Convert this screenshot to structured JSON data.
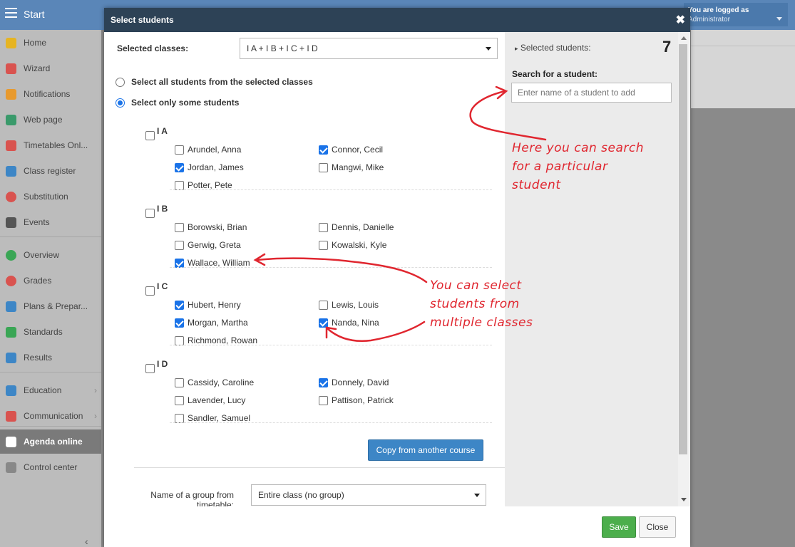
{
  "topbar": {
    "title": "Start"
  },
  "user": {
    "line1": "You are logged as",
    "line2": "Administrator"
  },
  "sidebar": {
    "items": [
      {
        "label": "Home",
        "icon": "star-icon",
        "color": "#e6b422"
      },
      {
        "label": "Wizard",
        "icon": "wand-icon",
        "color": "#d9534f"
      },
      {
        "label": "Notifications",
        "icon": "envelope-icon",
        "color": "#e89a2e"
      },
      {
        "label": "Web page",
        "icon": "house-icon",
        "color": "#3a9a6b"
      },
      {
        "label": "Timetables Onl...",
        "icon": "calendar-grid-icon",
        "color": "#d9534f"
      },
      {
        "label": "Class register",
        "icon": "book-icon",
        "color": "#3d86c6"
      },
      {
        "label": "Substitution",
        "icon": "person-icon",
        "color": "#d9534f"
      },
      {
        "label": "Events",
        "icon": "calendar-icon",
        "color": "#555555"
      },
      {
        "label": "Overview",
        "icon": "check-circle-icon",
        "color": "#3aa655"
      },
      {
        "label": "Grades",
        "icon": "chart-circle-icon",
        "color": "#d9534f"
      },
      {
        "label": "Plans & Prepar...",
        "icon": "briefcase-icon",
        "color": "#3d86c6"
      },
      {
        "label": "Standards",
        "icon": "shield-check-icon",
        "color": "#3aa655"
      },
      {
        "label": "Results",
        "icon": "bar-chart-icon",
        "color": "#3d86c6"
      },
      {
        "label": "Education",
        "icon": "books-icon",
        "color": "#3d86c6"
      },
      {
        "label": "Communication",
        "icon": "chat-icon",
        "color": "#d9534f"
      },
      {
        "label": "Agenda online",
        "icon": "feather-icon",
        "color": "#ffffff"
      },
      {
        "label": "Control center",
        "icon": "gear-icon",
        "color": "#888888"
      }
    ]
  },
  "modal": {
    "title": "Select students",
    "classes_label": "Selected classes:",
    "classes_value": "I A + I B + I C + I D",
    "radio_all": "Select all students from the selected classes",
    "radio_some": "Select only some students",
    "groups": [
      {
        "name": "I A",
        "students": [
          {
            "name": "Arundel, Anna",
            "checked": false
          },
          {
            "name": "Connor, Cecil",
            "checked": true
          },
          {
            "name": "Jordan, James",
            "checked": true
          },
          {
            "name": "Mangwi, Mike",
            "checked": false
          },
          {
            "name": "Potter, Pete",
            "checked": false
          }
        ]
      },
      {
        "name": "I B",
        "students": [
          {
            "name": "Borowski, Brian",
            "checked": false
          },
          {
            "name": "Dennis, Danielle",
            "checked": false
          },
          {
            "name": "Gerwig, Greta",
            "checked": false
          },
          {
            "name": "Kowalski, Kyle",
            "checked": false
          },
          {
            "name": "Wallace, William",
            "checked": true
          }
        ]
      },
      {
        "name": "I C",
        "students": [
          {
            "name": "Hubert, Henry",
            "checked": true
          },
          {
            "name": "Lewis, Louis",
            "checked": false
          },
          {
            "name": "Morgan, Martha",
            "checked": true
          },
          {
            "name": "Nanda, Nina",
            "checked": true
          },
          {
            "name": "Richmond, Rowan",
            "checked": false
          }
        ]
      },
      {
        "name": "I D",
        "students": [
          {
            "name": "Cassidy, Caroline",
            "checked": false
          },
          {
            "name": "Donnely, David",
            "checked": true
          },
          {
            "name": "Lavender, Lucy",
            "checked": false
          },
          {
            "name": "Pattison, Patrick",
            "checked": false
          },
          {
            "name": "Sandler, Samuel",
            "checked": false
          }
        ]
      }
    ],
    "copy_button": "Copy from another course",
    "group_label": "Name of a group from timetable:",
    "group_value": "Entire class (no group)",
    "selected_label": "Selected students:",
    "selected_count": "7",
    "search_label": "Search for a student:",
    "search_placeholder": "Enter name of a student to add",
    "save_button": "Save",
    "close_button": "Close"
  },
  "annotations": {
    "search_note": [
      "Here you can search",
      "for a particular",
      "student"
    ],
    "multi_note": [
      "You can select",
      "students from",
      "multiple classes"
    ]
  },
  "colors": {
    "accent": "#1a73e8",
    "header": "#2d4256",
    "annotation": "#e0262f",
    "save": "#4cae4c"
  }
}
